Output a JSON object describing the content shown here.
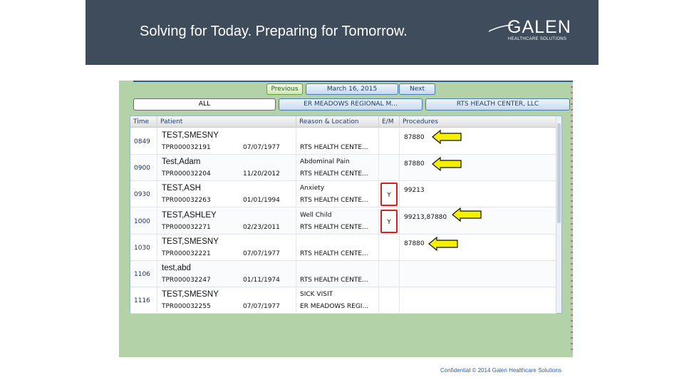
{
  "banner": {
    "tagline": "Solving for Today. Preparing for Tomorrow.",
    "logo_word": "GALEN",
    "logo_sub": "HEALTHCARE SOLUTIONS"
  },
  "app": {
    "nav": {
      "previous": "Previous",
      "date": "March 16, 2015",
      "next": "Next"
    },
    "tabs": [
      "ALL",
      "ER MEADOWS REGIONAL M...",
      "RTS HEALTH CENTER, LLC"
    ],
    "columns": [
      "Time",
      "Patient",
      "Reason & Location",
      "E/M",
      "Procedures"
    ],
    "rows": [
      {
        "time": "0849",
        "name": "TEST,SMESNY",
        "id": "TPR000032191",
        "dob": "07/07/1977",
        "reason": "",
        "location": "RTS HEALTH CENTE...",
        "em": "",
        "procedures": "87880"
      },
      {
        "time": "0900",
        "name": "Test,Adam",
        "id": "TPR000032204",
        "dob": "11/20/2012",
        "reason": "Abdominal Pain",
        "location": "RTS HEALTH CENTE...",
        "em": "",
        "procedures": "87880"
      },
      {
        "time": "0930",
        "name": "TEST,ASH",
        "id": "TPR000032263",
        "dob": "01/01/1994",
        "reason": "Anxiety",
        "location": "RTS HEALTH CENTE...",
        "em": "Y",
        "procedures": "99213"
      },
      {
        "time": "1000",
        "name": "TEST,ASHLEY",
        "id": "TPR000032271",
        "dob": "02/23/2011",
        "reason": "Well Child",
        "location": "RTS HEALTH CENTE...",
        "em": "Y",
        "procedures": "99213,87880"
      },
      {
        "time": "1030",
        "name": "TEST,SMESNY",
        "id": "TPR000032221",
        "dob": "07/07/1977",
        "reason": "",
        "location": "RTS HEALTH CENTE...",
        "em": "",
        "procedures": "87880"
      },
      {
        "time": "1106",
        "name": "test,abd",
        "id": "TPR000032247",
        "dob": "01/11/1974",
        "reason": "",
        "location": "RTS HEALTH CENTE...",
        "em": "",
        "procedures": ""
      },
      {
        "time": "1116",
        "name": "TEST,SMESNY",
        "id": "TPR000032255",
        "dob": "07/07/1977",
        "reason": "SICK VISIT",
        "location": "ER MEADOWS REGI...",
        "em": "",
        "procedures": ""
      }
    ]
  },
  "colors": {
    "banner": "#3e4c5c",
    "app_bg": "#b4d2a8",
    "arrow_fill": "#f5f000",
    "highlight": "#d81f1f",
    "footer": "#2d5fa0"
  },
  "footer": "Confidential © 2014 Galen Healthcare Solutions"
}
